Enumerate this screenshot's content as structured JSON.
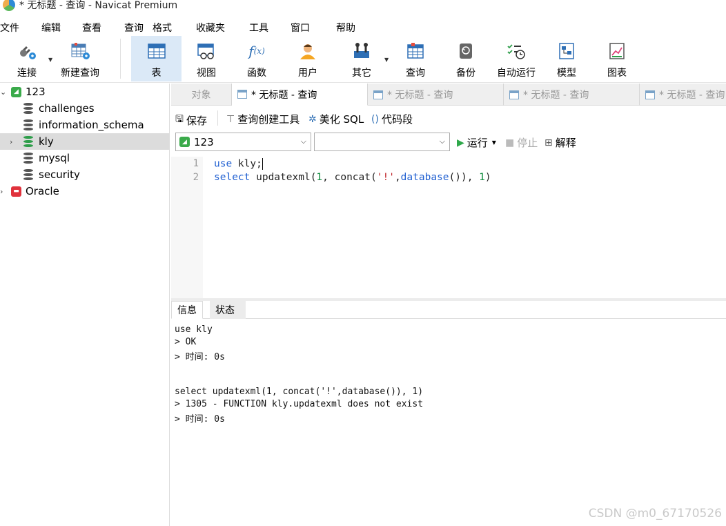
{
  "window": {
    "title": "* 无标题 - 查询 - Navicat Premium"
  },
  "menu": [
    "文件",
    "编辑",
    "查看",
    "查询",
    "格式",
    "收藏夹",
    "工具",
    "窗口",
    "帮助"
  ],
  "toolbar": {
    "connect": "连接",
    "new_query": "新建查询",
    "table": "表",
    "view": "视图",
    "function": "函数",
    "user": "用户",
    "other": "其它",
    "query": "查询",
    "backup": "备份",
    "auto_run": "自动运行",
    "model": "模型",
    "chart": "图表"
  },
  "tree": {
    "connection": "123",
    "databases": [
      "challenges",
      "information_schema",
      "kly",
      "mysql",
      "security"
    ],
    "selected": "kly",
    "connection2": "Oracle"
  },
  "tabs": {
    "objects": "对象",
    "active": "* 无标题 - 查询",
    "others": [
      "* 无标题 - 查询",
      "* 无标题 - 查询",
      "* 无标题 - 查询"
    ]
  },
  "query_tools": {
    "save": "保存",
    "builder": "查询创建工具",
    "beautify": "美化 SQL",
    "snippet": "代码段"
  },
  "selectors": {
    "connection_value": "123",
    "database_value": "",
    "run": "运行",
    "stop": "停止",
    "explain": "解释"
  },
  "editor": {
    "line_numbers": [
      "1",
      "2"
    ],
    "line1": {
      "kw": "use",
      "rest": " kly;"
    },
    "line2": {
      "kw": "select",
      "p1": " updatexml(",
      "n1": "1",
      "p2": ", concat(",
      "s1": "'!'",
      "p3": ",",
      "fn": "database",
      "p4": "()), ",
      "n2": "1",
      "p5": ")"
    }
  },
  "result_tabs": {
    "info": "信息",
    "status": "状态"
  },
  "output": [
    "use kly",
    "> OK",
    "> 时间: 0s",
    "select updatexml(1, concat('!',database()), 1)",
    "> 1305 - FUNCTION kly.updatexml does not exist",
    "> 时间: 0s"
  ],
  "watermark": "CSDN @m0_67170526",
  "colors": {
    "accent": "#1f5fd1",
    "selection": "#dcdcdc",
    "active_tool": "#dbe9f7"
  }
}
